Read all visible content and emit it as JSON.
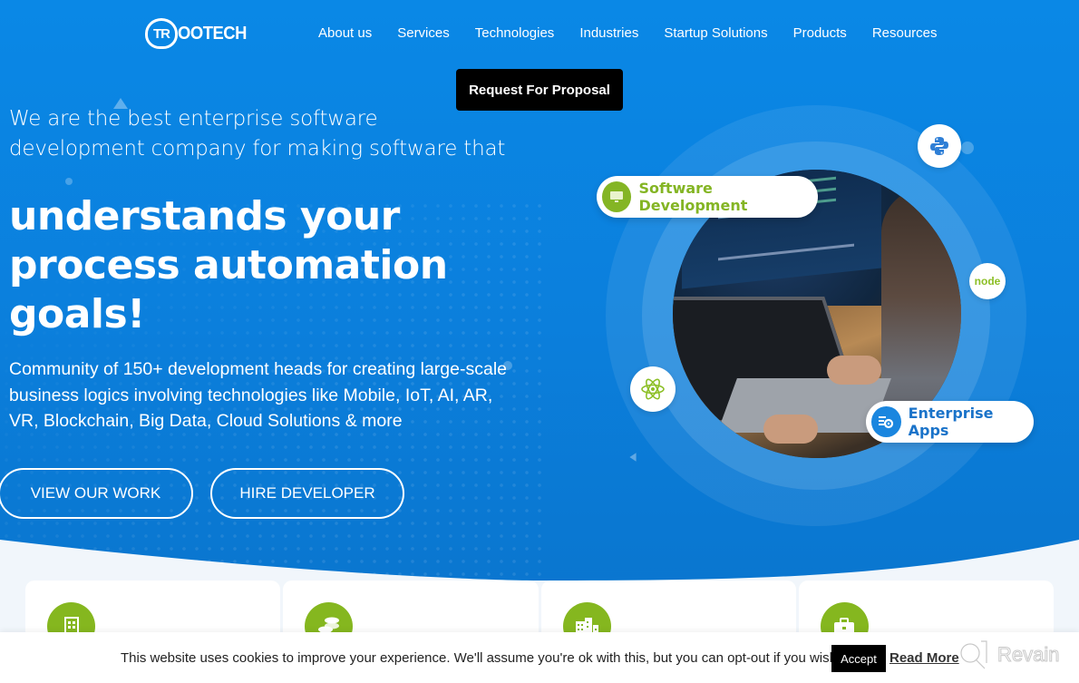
{
  "brand": {
    "logo_mark": "TR",
    "logo_text": "OOTECH"
  },
  "nav": {
    "items": [
      "About us",
      "Services",
      "Technologies",
      "Industries",
      "Startup Solutions",
      "Products",
      "Resources"
    ],
    "cta_label": "Request For Proposal"
  },
  "hero": {
    "intro": "We are the best enterprise software development company for making software that",
    "headline": "understands your process automation goals!",
    "description": "Community of 150+ development heads for creating large-scale business logics involving technologies like Mobile, IoT, AI, AR, VR, Blockchain, Big Data, Cloud Solutions & more",
    "buttons": {
      "view_work": "VIEW OUR WORK",
      "hire_developer": "HIRE DEVELOPER"
    }
  },
  "visual": {
    "pill_software": "Software Development",
    "pill_enterprise": "Enterprise Apps",
    "badges": {
      "python": "python-logo",
      "node": "node",
      "react": "react-logo"
    }
  },
  "cards": [
    {
      "icon": "building-icon"
    },
    {
      "icon": "coins-icon"
    },
    {
      "icon": "city-icon"
    },
    {
      "icon": "briefcase-icon"
    }
  ],
  "cookie": {
    "message": "This website uses cookies to improve your experience. We'll assume you're ok with this, but you can opt-out if you wish.",
    "accept_label": "Accept",
    "read_more_label": "Read More"
  },
  "watermark": {
    "text": "Revain"
  },
  "colors": {
    "hero_blue": "#0a88e6",
    "accent_green": "#84b524",
    "enterprise_blue": "#1a73c9",
    "cta_black": "#000000"
  }
}
